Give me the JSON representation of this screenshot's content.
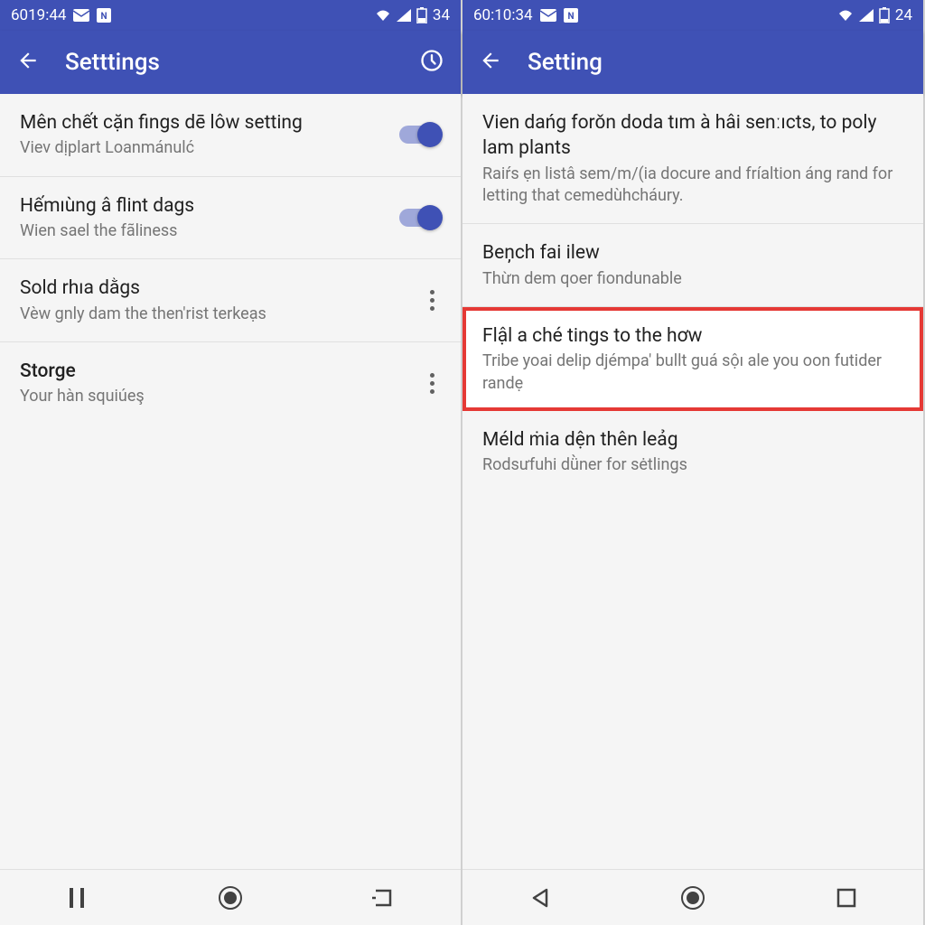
{
  "left": {
    "status": {
      "time": "6019:44",
      "battery": "34"
    },
    "appbar": {
      "title": "Setttings"
    },
    "items": [
      {
        "title": "Mên chết cặn fings dē lôw setting",
        "subtitle": "Viev dịplart Loanmánulć"
      },
      {
        "title": "Hếmıùng â flint dags",
        "subtitle": "Wien sael the fãliness"
      },
      {
        "title": "Sold rhıa dằgs",
        "subtitle": "Vèw gnly dam the then'rist terkeạs"
      },
      {
        "title": "Storge",
        "subtitle": "Your hàn squiúeş"
      }
    ]
  },
  "right": {
    "status": {
      "time": "60:10:34",
      "battery": "24"
    },
    "appbar": {
      "title": "Setting"
    },
    "items": [
      {
        "title": "Vien dańg forǒn doda tım à hâi senːıcts, to poly lam plants",
        "subtitle": "Raiŕs ẹn listâ sem/m/(ia docure and fríaltion áng rand for letting that cemedùhcháury."
      },
      {
        "title": "Beņch fai ilew",
        "subtitle": "Thừn dem qoer fiondunable"
      },
      {
        "title": "Flậl a ché tings to the hơw",
        "subtitle": "Tribe yoai delip djémpa' bullt guá sộı ale you oon futider randẹ"
      },
      {
        "title": "Méld ṁia dện thên leảg",
        "subtitle": "Rodsưfuhi dǜner for sėtlings"
      }
    ]
  }
}
